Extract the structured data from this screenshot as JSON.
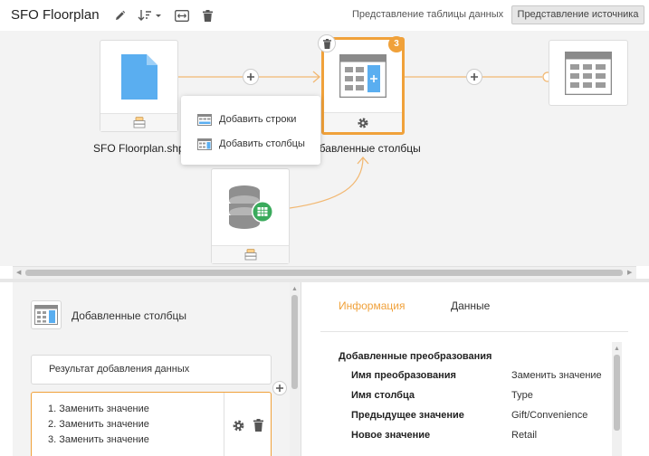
{
  "header": {
    "title": "SFO Floorplan",
    "table_view_label": "Представление таблицы данных",
    "source_view_label": "Представление источника"
  },
  "canvas": {
    "source_node_label": "SFO Floorplan.shp",
    "step_node_label": "добавленные столбцы",
    "step_badge": "3",
    "popup": {
      "add_rows": "Добавить строки",
      "add_columns": "Добавить столбцы"
    }
  },
  "left_panel": {
    "step_title": "Добавленные столбцы",
    "result_label": "Результат добавления данных",
    "transformations": [
      "1. Заменить значение",
      "2. Заменить значение",
      "3. Заменить значение"
    ]
  },
  "right_panel": {
    "tabs": [
      "Информация",
      "Данные"
    ],
    "section_title": "Добавленные преобразования",
    "rows": [
      {
        "key": "Имя преобразования",
        "value": "Заменить значение"
      },
      {
        "key": "Имя столбца",
        "value": "Type"
      },
      {
        "key": "Предыдущее значение",
        "value": "Gift/Convenience"
      },
      {
        "key": "Новое значение",
        "value": "Retail"
      }
    ]
  },
  "colors": {
    "accent": "#f0a13a",
    "file_blue": "#5aaef0",
    "sheet_green": "#3aaa5c"
  }
}
